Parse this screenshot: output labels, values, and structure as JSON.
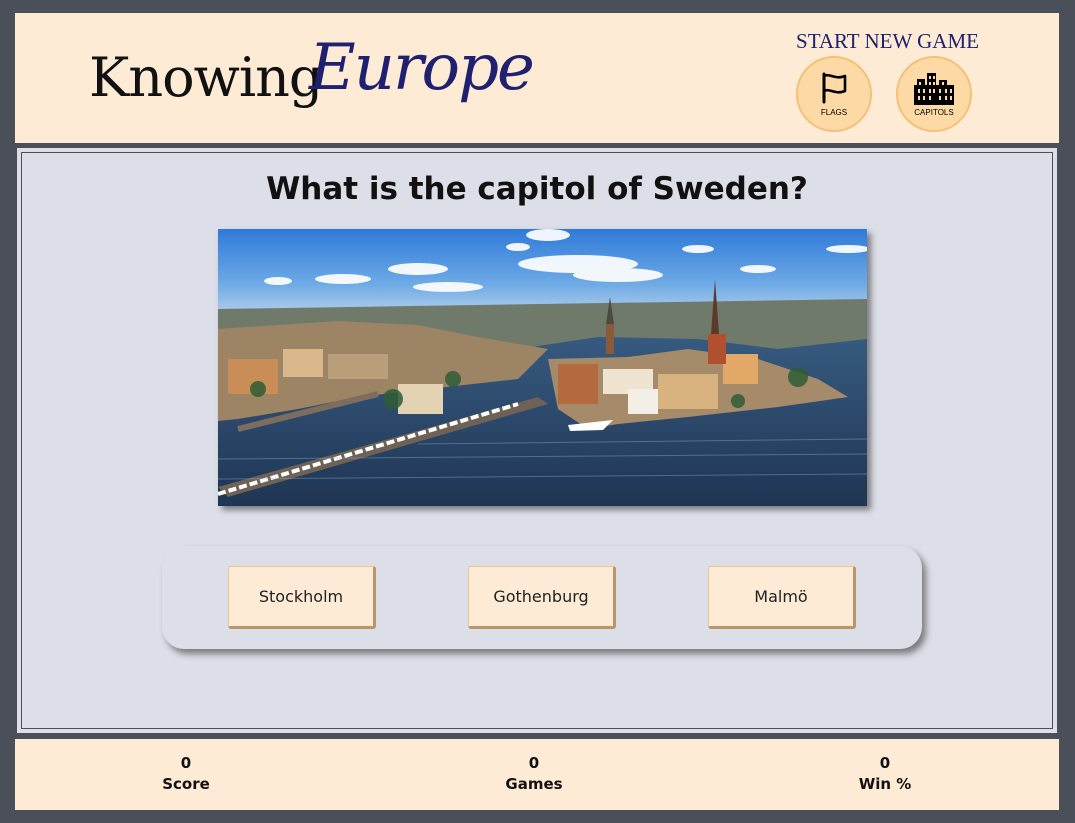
{
  "header": {
    "logo_part1": "Knowing",
    "logo_part2": "Europe",
    "new_game_label": "START NEW GAME",
    "modes": [
      {
        "label": "FLAGS",
        "icon": "flag-icon"
      },
      {
        "label": "CAPITOLS",
        "icon": "city-skyline-icon"
      }
    ]
  },
  "quiz": {
    "question": "What is the capitol of Sweden?",
    "image_icon": "stockholm-city-photo",
    "answers": [
      "Stockholm",
      "Gothenburg",
      "Malmö"
    ]
  },
  "stats": {
    "score_value": "0",
    "score_label": "Score",
    "games_value": "0",
    "games_label": "Games",
    "win_value": "0",
    "win_label": "Win %"
  },
  "colors": {
    "page_bg": "#4b4f5a",
    "panel_bg": "#feebd6",
    "main_bg": "#dcdfe7",
    "accent_navy": "#1f2070",
    "button_fill": "#fdd9a5"
  }
}
